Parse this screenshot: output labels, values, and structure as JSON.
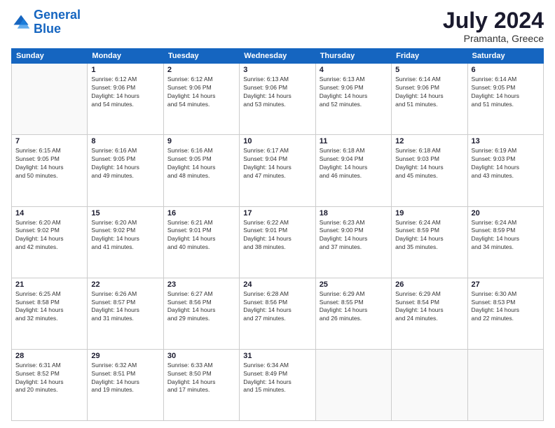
{
  "logo": {
    "line1": "General",
    "line2": "Blue"
  },
  "title": "July 2024",
  "location": "Pramanta, Greece",
  "header_days": [
    "Sunday",
    "Monday",
    "Tuesday",
    "Wednesday",
    "Thursday",
    "Friday",
    "Saturday"
  ],
  "weeks": [
    [
      {
        "day": "",
        "info": ""
      },
      {
        "day": "1",
        "info": "Sunrise: 6:12 AM\nSunset: 9:06 PM\nDaylight: 14 hours\nand 54 minutes."
      },
      {
        "day": "2",
        "info": "Sunrise: 6:12 AM\nSunset: 9:06 PM\nDaylight: 14 hours\nand 54 minutes."
      },
      {
        "day": "3",
        "info": "Sunrise: 6:13 AM\nSunset: 9:06 PM\nDaylight: 14 hours\nand 53 minutes."
      },
      {
        "day": "4",
        "info": "Sunrise: 6:13 AM\nSunset: 9:06 PM\nDaylight: 14 hours\nand 52 minutes."
      },
      {
        "day": "5",
        "info": "Sunrise: 6:14 AM\nSunset: 9:06 PM\nDaylight: 14 hours\nand 51 minutes."
      },
      {
        "day": "6",
        "info": "Sunrise: 6:14 AM\nSunset: 9:05 PM\nDaylight: 14 hours\nand 51 minutes."
      }
    ],
    [
      {
        "day": "7",
        "info": "Sunrise: 6:15 AM\nSunset: 9:05 PM\nDaylight: 14 hours\nand 50 minutes."
      },
      {
        "day": "8",
        "info": "Sunrise: 6:16 AM\nSunset: 9:05 PM\nDaylight: 14 hours\nand 49 minutes."
      },
      {
        "day": "9",
        "info": "Sunrise: 6:16 AM\nSunset: 9:05 PM\nDaylight: 14 hours\nand 48 minutes."
      },
      {
        "day": "10",
        "info": "Sunrise: 6:17 AM\nSunset: 9:04 PM\nDaylight: 14 hours\nand 47 minutes."
      },
      {
        "day": "11",
        "info": "Sunrise: 6:18 AM\nSunset: 9:04 PM\nDaylight: 14 hours\nand 46 minutes."
      },
      {
        "day": "12",
        "info": "Sunrise: 6:18 AM\nSunset: 9:03 PM\nDaylight: 14 hours\nand 45 minutes."
      },
      {
        "day": "13",
        "info": "Sunrise: 6:19 AM\nSunset: 9:03 PM\nDaylight: 14 hours\nand 43 minutes."
      }
    ],
    [
      {
        "day": "14",
        "info": "Sunrise: 6:20 AM\nSunset: 9:02 PM\nDaylight: 14 hours\nand 42 minutes."
      },
      {
        "day": "15",
        "info": "Sunrise: 6:20 AM\nSunset: 9:02 PM\nDaylight: 14 hours\nand 41 minutes."
      },
      {
        "day": "16",
        "info": "Sunrise: 6:21 AM\nSunset: 9:01 PM\nDaylight: 14 hours\nand 40 minutes."
      },
      {
        "day": "17",
        "info": "Sunrise: 6:22 AM\nSunset: 9:01 PM\nDaylight: 14 hours\nand 38 minutes."
      },
      {
        "day": "18",
        "info": "Sunrise: 6:23 AM\nSunset: 9:00 PM\nDaylight: 14 hours\nand 37 minutes."
      },
      {
        "day": "19",
        "info": "Sunrise: 6:24 AM\nSunset: 8:59 PM\nDaylight: 14 hours\nand 35 minutes."
      },
      {
        "day": "20",
        "info": "Sunrise: 6:24 AM\nSunset: 8:59 PM\nDaylight: 14 hours\nand 34 minutes."
      }
    ],
    [
      {
        "day": "21",
        "info": "Sunrise: 6:25 AM\nSunset: 8:58 PM\nDaylight: 14 hours\nand 32 minutes."
      },
      {
        "day": "22",
        "info": "Sunrise: 6:26 AM\nSunset: 8:57 PM\nDaylight: 14 hours\nand 31 minutes."
      },
      {
        "day": "23",
        "info": "Sunrise: 6:27 AM\nSunset: 8:56 PM\nDaylight: 14 hours\nand 29 minutes."
      },
      {
        "day": "24",
        "info": "Sunrise: 6:28 AM\nSunset: 8:56 PM\nDaylight: 14 hours\nand 27 minutes."
      },
      {
        "day": "25",
        "info": "Sunrise: 6:29 AM\nSunset: 8:55 PM\nDaylight: 14 hours\nand 26 minutes."
      },
      {
        "day": "26",
        "info": "Sunrise: 6:29 AM\nSunset: 8:54 PM\nDaylight: 14 hours\nand 24 minutes."
      },
      {
        "day": "27",
        "info": "Sunrise: 6:30 AM\nSunset: 8:53 PM\nDaylight: 14 hours\nand 22 minutes."
      }
    ],
    [
      {
        "day": "28",
        "info": "Sunrise: 6:31 AM\nSunset: 8:52 PM\nDaylight: 14 hours\nand 20 minutes."
      },
      {
        "day": "29",
        "info": "Sunrise: 6:32 AM\nSunset: 8:51 PM\nDaylight: 14 hours\nand 19 minutes."
      },
      {
        "day": "30",
        "info": "Sunrise: 6:33 AM\nSunset: 8:50 PM\nDaylight: 14 hours\nand 17 minutes."
      },
      {
        "day": "31",
        "info": "Sunrise: 6:34 AM\nSunset: 8:49 PM\nDaylight: 14 hours\nand 15 minutes."
      },
      {
        "day": "",
        "info": ""
      },
      {
        "day": "",
        "info": ""
      },
      {
        "day": "",
        "info": ""
      }
    ]
  ]
}
